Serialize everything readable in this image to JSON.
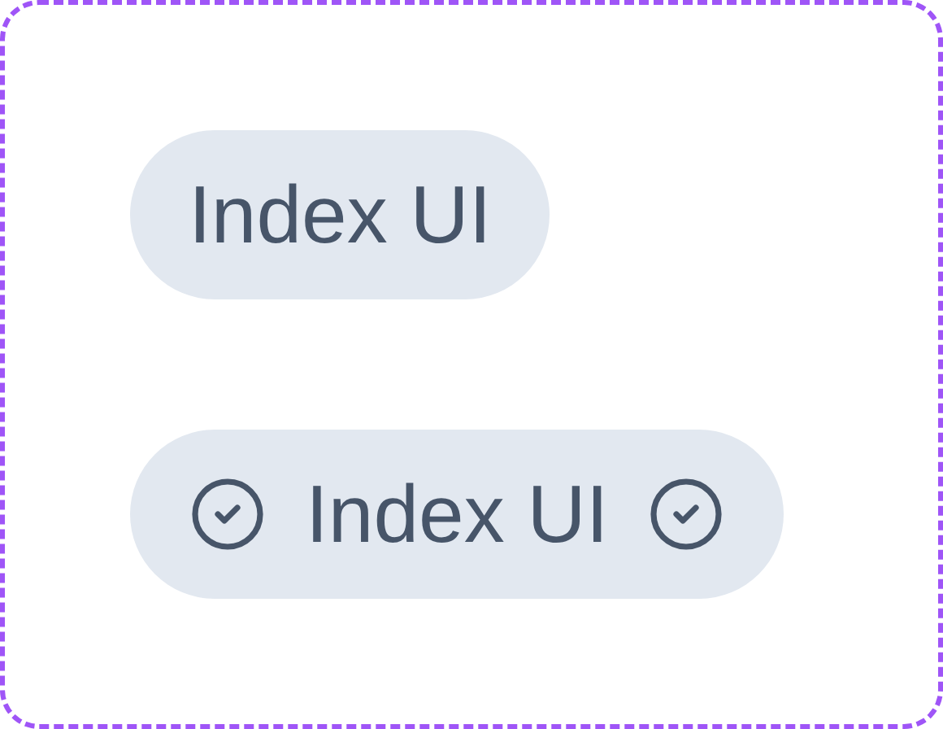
{
  "badges": [
    {
      "label": "Index UI",
      "kind": "plain"
    },
    {
      "label": "Index UI",
      "kind": "with-icons"
    }
  ]
}
